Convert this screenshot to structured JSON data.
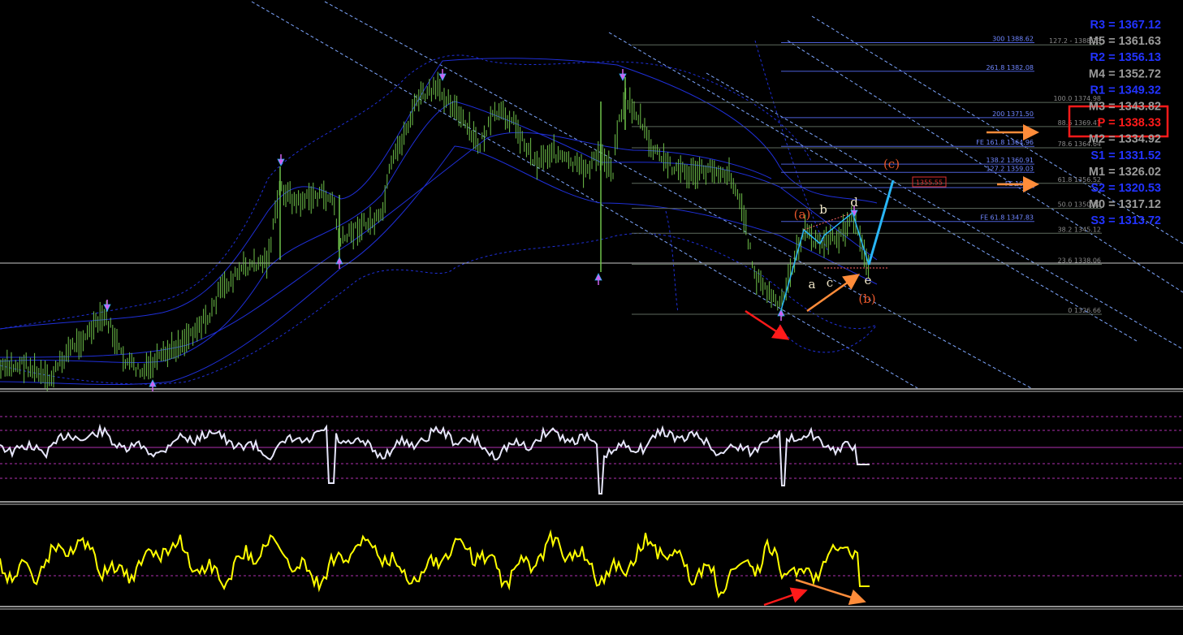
{
  "chart_data": [
    {
      "type": "candlestick",
      "panel": "price",
      "ylim": [
        1300,
        1400
      ],
      "horizontal_line": 1338.33,
      "fib_levels_right": [
        {
          "label": "127.2 - 1388.13",
          "value": 1388.13
        },
        {
          "label": "100.0 1374.98",
          "value": 1374.98
        },
        {
          "label": "88.6 1369.47",
          "value": 1369.47
        },
        {
          "label": "78.6 1364.64",
          "value": 1364.64
        },
        {
          "label": "61.8 1356.52",
          "value": 1356.52
        },
        {
          "label": "50.0 1350.82",
          "value": 1350.82
        },
        {
          "label": "38.2 1345.12",
          "value": 1345.12
        },
        {
          "label": "23.6 1338.06",
          "value": 1338.06
        },
        {
          "label": "0 1326.66",
          "value": 1326.66
        }
      ],
      "fib_extensions": [
        {
          "label": "300 1388.62",
          "value": 1388.62
        },
        {
          "label": "261.8 1382.08",
          "value": 1382.08
        },
        {
          "label": "200 1371.50",
          "value": 1371.5
        },
        {
          "label": "FE 161.8 1364.96",
          "value": 1364.96
        },
        {
          "label": "138.2 1360.91",
          "value": 1360.91
        },
        {
          "label": "127.2 1359.03",
          "value": 1359.03
        },
        {
          "label": "FE 100.0",
          "value": 1355.55
        },
        {
          "label": "FE 61.8 1347.83",
          "value": 1347.83
        }
      ],
      "target_box": "1355.55",
      "pivot_levels": [
        {
          "label": "R3 = 1367.12",
          "color": "#2233ff"
        },
        {
          "label": "M5 = 1361.63",
          "color": "#9a9a9a"
        },
        {
          "label": "R2 = 1356.13",
          "color": "#2233ff"
        },
        {
          "label": "M4 = 1352.72",
          "color": "#9a9a9a"
        },
        {
          "label": "R1 = 1349.32",
          "color": "#2233ff"
        },
        {
          "label": "M3 = 1343.82",
          "color": "#9a9a9a"
        },
        {
          "label": "P = 1338.33",
          "color": "#ff1a1a"
        },
        {
          "label": "M2 = 1334.92",
          "color": "#9a9a9a"
        },
        {
          "label": "S1 = 1331.52",
          "color": "#2233ff"
        },
        {
          "label": "M1 = 1326.02",
          "color": "#9a9a9a"
        },
        {
          "label": "S2 = 1320.53",
          "color": "#2233ff"
        },
        {
          "label": "M0 = 1317.12",
          "color": "#9a9a9a"
        },
        {
          "label": "S3 = 1313.72",
          "color": "#2233ff"
        }
      ],
      "wave_labels": [
        {
          "text": "(a)",
          "color": "#e8572a"
        },
        {
          "text": "b",
          "color": "#f0e6c8"
        },
        {
          "text": "d",
          "color": "#f0e6c8"
        },
        {
          "text": "a",
          "color": "#f0e6c8"
        },
        {
          "text": "c",
          "color": "#f0e6c8"
        },
        {
          "text": "e",
          "color": "#f0e6c8"
        },
        {
          "text": "(b)",
          "color": "#e8572a"
        },
        {
          "text": "(c)",
          "color": "#e8572a"
        }
      ],
      "colors": {
        "candles": "#6fc24a",
        "bands": "#1f2fd8",
        "channel": "#7fa7ff",
        "projection": "#29b6f6"
      }
    },
    {
      "type": "line",
      "panel": "oscillator-1",
      "color": "#e6e6fa",
      "levels": [
        "upper-dotted",
        "middle-solid",
        "lower-dotted"
      ]
    },
    {
      "type": "line",
      "panel": "oscillator-2",
      "color": "#ffff00",
      "levels": [
        "middle-dotted"
      ]
    }
  ]
}
